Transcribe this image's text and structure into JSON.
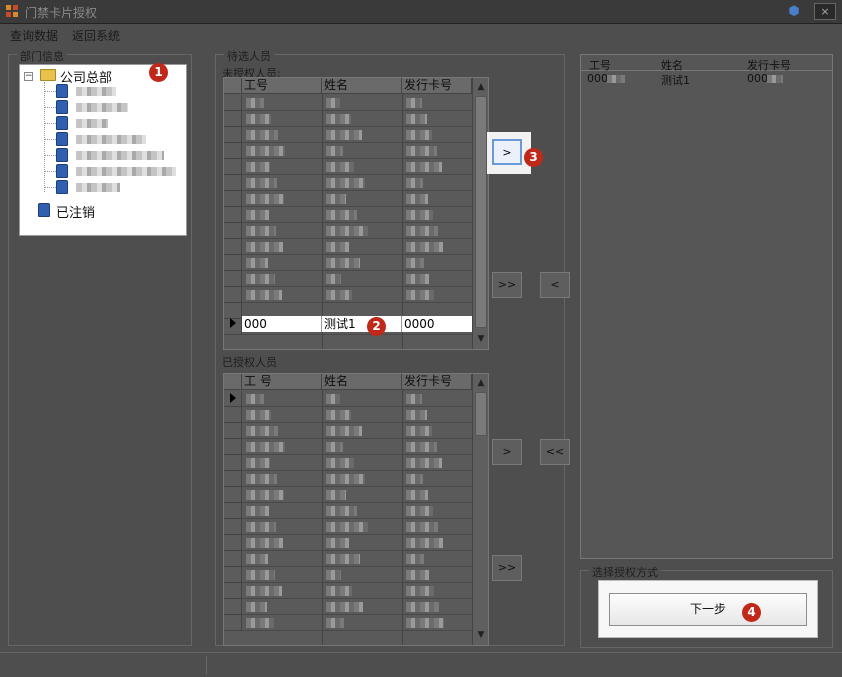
{
  "window": {
    "title": "门禁卡片授权",
    "close_label": "×"
  },
  "menu": [
    {
      "label": "查询数据"
    },
    {
      "label": "返回系统"
    }
  ],
  "dept_panel": {
    "label": "部门信息",
    "root": {
      "label": "公司总部",
      "expander": "−"
    },
    "children_count": 7,
    "cancelled": {
      "label": "已注销"
    }
  },
  "candidate_panel": {
    "label": "待选人员",
    "unauthorized_label": "未授权人员:",
    "columns": [
      "工号",
      "姓名",
      "发行卡号"
    ],
    "selected_row": {
      "id": "000",
      "name": "测试1",
      "card": "0000"
    }
  },
  "authorized_panel": {
    "label": "已授权人员",
    "columns": [
      "工 号",
      "姓名",
      "发行卡号"
    ]
  },
  "buttons": {
    "move_one": ">",
    "move_all": ">>",
    "move_back_one": "<",
    "move_back_all": "<<",
    "lower_move_one": ">",
    "lower_move_all": ">>"
  },
  "result_list": {
    "columns": [
      "工号",
      "姓名",
      "发行卡号"
    ],
    "rows": [
      {
        "id": "000",
        "name": "测试1",
        "card": "000"
      }
    ]
  },
  "auth_mode": {
    "label": "选择授权方式",
    "next_label": "下一步"
  },
  "annotations": [
    "1",
    "2",
    "3",
    "4"
  ],
  "colors": {
    "badge": "#c0281a",
    "active_button_border": "#6a9ad8",
    "folder": "#e8c24a",
    "person": "#2f5fae"
  },
  "icons": {
    "app": "app-icon",
    "shield": "shield-icon",
    "folder": "folder-icon",
    "person": "person-icon"
  }
}
